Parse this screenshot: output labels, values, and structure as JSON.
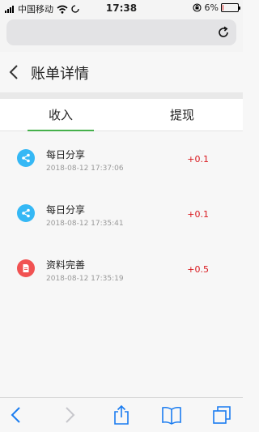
{
  "status_bar": {
    "carrier": "中国移动",
    "time": "17:38",
    "battery_percent": "6%",
    "battery_level": 0.06,
    "icons": [
      "signal-icon",
      "wifi-icon",
      "loading-icon",
      "rotation-lock-icon",
      "battery-icon"
    ]
  },
  "browser": {
    "url_text": "",
    "reload_icon": "reload-icon"
  },
  "header": {
    "back_icon": "chevron-left-icon",
    "title": "账单详情"
  },
  "tabs": [
    {
      "label": "收入",
      "active": true
    },
    {
      "label": "提现",
      "active": false
    }
  ],
  "colors": {
    "accent_green": "#45b04b",
    "amount_red": "#d9181e",
    "share_blue": "#35b8f5",
    "profile_red": "#f15252"
  },
  "records": [
    {
      "icon": "share-icon",
      "title": "每日分享",
      "time": "2018-08-12 17:37:06",
      "amount": "+0.1"
    },
    {
      "icon": "share-icon",
      "title": "每日分享",
      "time": "2018-08-12 17:35:41",
      "amount": "+0.1"
    },
    {
      "icon": "document-icon",
      "title": "资料完善",
      "time": "2018-08-12 17:35:19",
      "amount": "+0.5"
    }
  ],
  "toolbar": {
    "items": [
      "back-icon",
      "forward-icon",
      "share-icon",
      "bookmarks-icon",
      "tabs-icon"
    ]
  }
}
